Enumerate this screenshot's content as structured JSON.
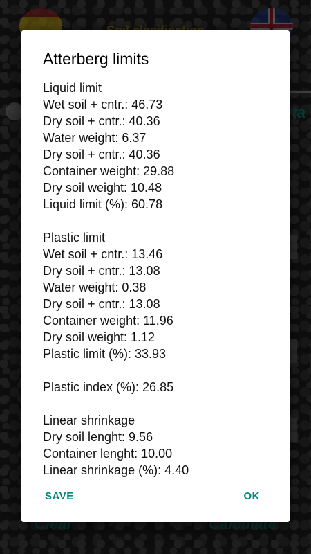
{
  "background": {
    "title": "Soil clasification",
    "ta_label": "ta",
    "clear_label": "Clear",
    "calculate_label": "Calculate"
  },
  "dialog": {
    "title": "Atterberg limits",
    "liquid": {
      "heading": "Liquid limit",
      "wet_soil": "Wet soil + cntr.: 46.73",
      "dry_soil": "Dry soil + cntr.: 40.36",
      "water_weight": "Water weight: 6.37",
      "dry_soil_2": "Dry soil + cntr.: 40.36",
      "container_weight": "Container weight: 29.88",
      "dry_soil_weight": "Dry soil weight: 10.48",
      "result": "Liquid limit (%): 60.78"
    },
    "plastic": {
      "heading": "Plastic limit",
      "wet_soil": "Wet soil + cntr.: 13.46",
      "dry_soil": "Dry soil + cntr.: 13.08",
      "water_weight": "Water weight: 0.38",
      "dry_soil_2": "Dry soil + cntr.: 13.08",
      "container_weight": "Container weight: 11.96",
      "dry_soil_weight": "Dry soil weight: 1.12",
      "result": "Plastic limit (%): 33.93"
    },
    "plastic_index": "Plastic index (%): 26.85",
    "shrinkage": {
      "heading": "Linear shrinkage",
      "dry_soil_length": "Dry soil lenght: 9.56",
      "container_length": "Container lenght: 10.00",
      "result": "Linear shrinkage (%): 4.40"
    },
    "save_label": "SAVE",
    "ok_label": "OK"
  },
  "colors": {
    "accent": "#00897b",
    "dialog_bg": "#ffffff"
  }
}
